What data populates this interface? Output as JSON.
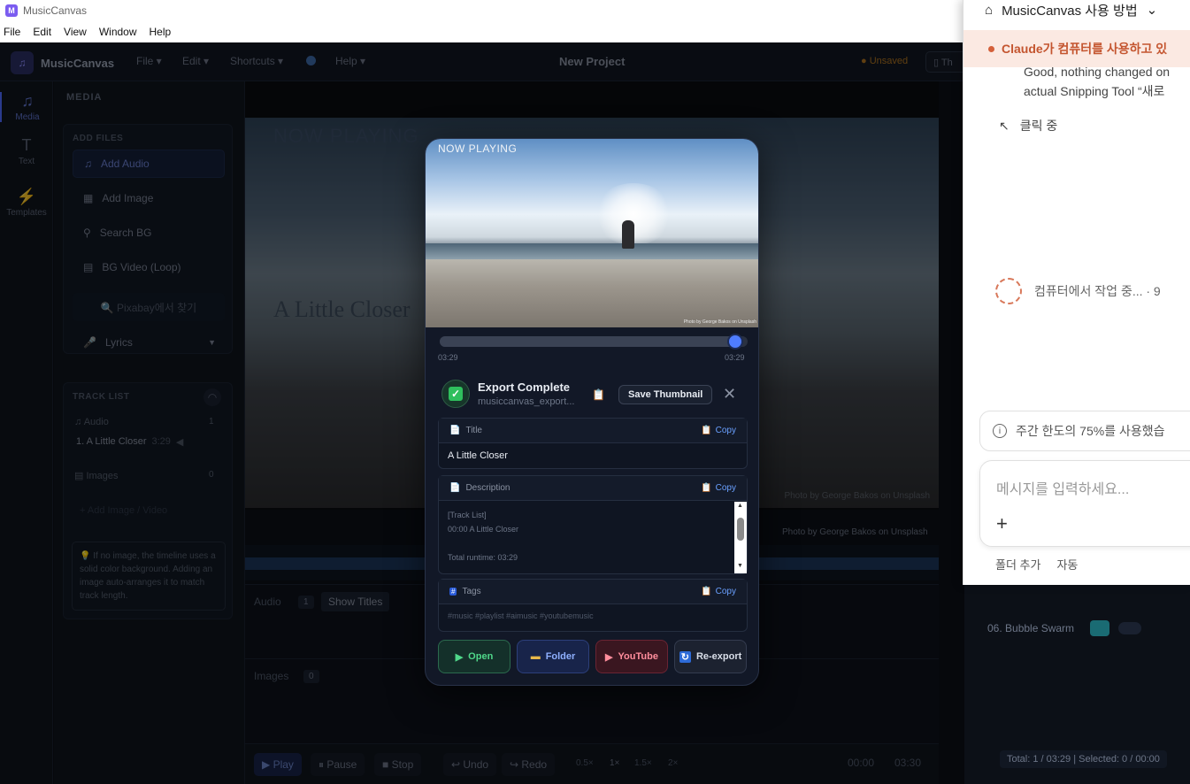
{
  "window": {
    "title": "MusicCanvas",
    "menu": [
      "File",
      "Edit",
      "View",
      "Window",
      "Help"
    ]
  },
  "app": {
    "brand": "MusicCanvas",
    "menus": [
      "File ▾",
      "Edit ▾",
      "Shortcuts ▾",
      "Help ▾"
    ],
    "project": "New Project",
    "unsaved": "● Unsaved",
    "theme_btn": "Th"
  },
  "rail": [
    {
      "label": "Media",
      "icon": "music-note-icon",
      "glyph": "♫"
    },
    {
      "label": "Text",
      "icon": "text-icon",
      "glyph": "T"
    },
    {
      "label": "Templates",
      "icon": "lightning-icon",
      "glyph": "⚡"
    }
  ],
  "media": {
    "header": "MEDIA",
    "add_files": "ADD FILES",
    "buttons": [
      "Add Audio",
      "Add Image",
      "Search BG",
      "BG Video (Loop)"
    ],
    "pixabay": "🔍 Pixabay에서 찾기",
    "lyrics": "Lyrics",
    "track_list": "TRACK LIST",
    "audio_label": "♫ Audio",
    "audio_count": "1",
    "track1": "1. A Little Closer",
    "track1_dur": "3:29",
    "images_label": "▤ Images",
    "images_count": "0",
    "add_image_video": "+ Add Image / Video",
    "tip": "💡 If no image, the timeline uses a solid color background. Adding an image auto-arranges it to match track length."
  },
  "stage": {
    "now_playing": "NOW PLAYING",
    "title_overlay": "A Little Closer",
    "credit": "Photo by George Bakos on Unsplash"
  },
  "timeline": {
    "audio_label": "Audio",
    "audio_count": "1",
    "show_titles": "Show Titles",
    "images_label": "Images",
    "images_count": "0"
  },
  "transport": {
    "play": "▶ Play",
    "pause": "⏸ Pause",
    "stop": "■ Stop",
    "undo": "↩ Undo",
    "redo": "↪ Redo",
    "speeds": [
      "0.5×",
      "1×",
      "1.5×",
      "2×"
    ],
    "time_current": "00:00",
    "time_total": "03:30"
  },
  "right": {
    "bubble": "06. Bubble Swarm",
    "totals": "Total: 1 / 03:29 | Selected: 0 / 00:00"
  },
  "modal": {
    "now_playing": "NOW PLAYING",
    "image_credit": "Photo by George Bakos on Unsplash",
    "progress": {
      "elapsed": "03:29",
      "total": "03:29",
      "fraction": 0.96
    },
    "status_title": "Export Complete",
    "status_file": "musiccanvas_export...",
    "save_thumbnail": "Save Thumbnail",
    "copy": "Copy",
    "title_label": "Title",
    "title_value": "A Little Closer",
    "desc_label": "Description",
    "desc_lines": [
      "[Track List]",
      "00:00 A Little Closer",
      "",
      "Total runtime: 03:29"
    ],
    "tags_label": "Tags",
    "tags_value": "#music #playlist #aimusic #youtubemusic",
    "actions": {
      "open": "Open",
      "folder": "Folder",
      "youtube": "YouTube",
      "reexport": "Re-export"
    }
  },
  "claude": {
    "header": "MusicCanvas 사용 방법",
    "alert": "Claude가 컴퓨터를 사용하고 있",
    "log_line1": "Good, nothing changed on",
    "log_line2": "actual Snipping Tool “새로 ",
    "clicking": "클릭 중",
    "working": "컴퓨터에서 작업 중... · 9",
    "limit": "주간 한도의 75%를 사용했습",
    "input_placeholder": "메시지를 입력하세요...",
    "foot_add_folder": "폴더 추가",
    "foot_auto": "자동"
  },
  "colors": {
    "accent": "#4f7dff",
    "success": "#2fbf5d",
    "youtube": "#ff8d9c",
    "claude_alert": "#c4552f"
  }
}
